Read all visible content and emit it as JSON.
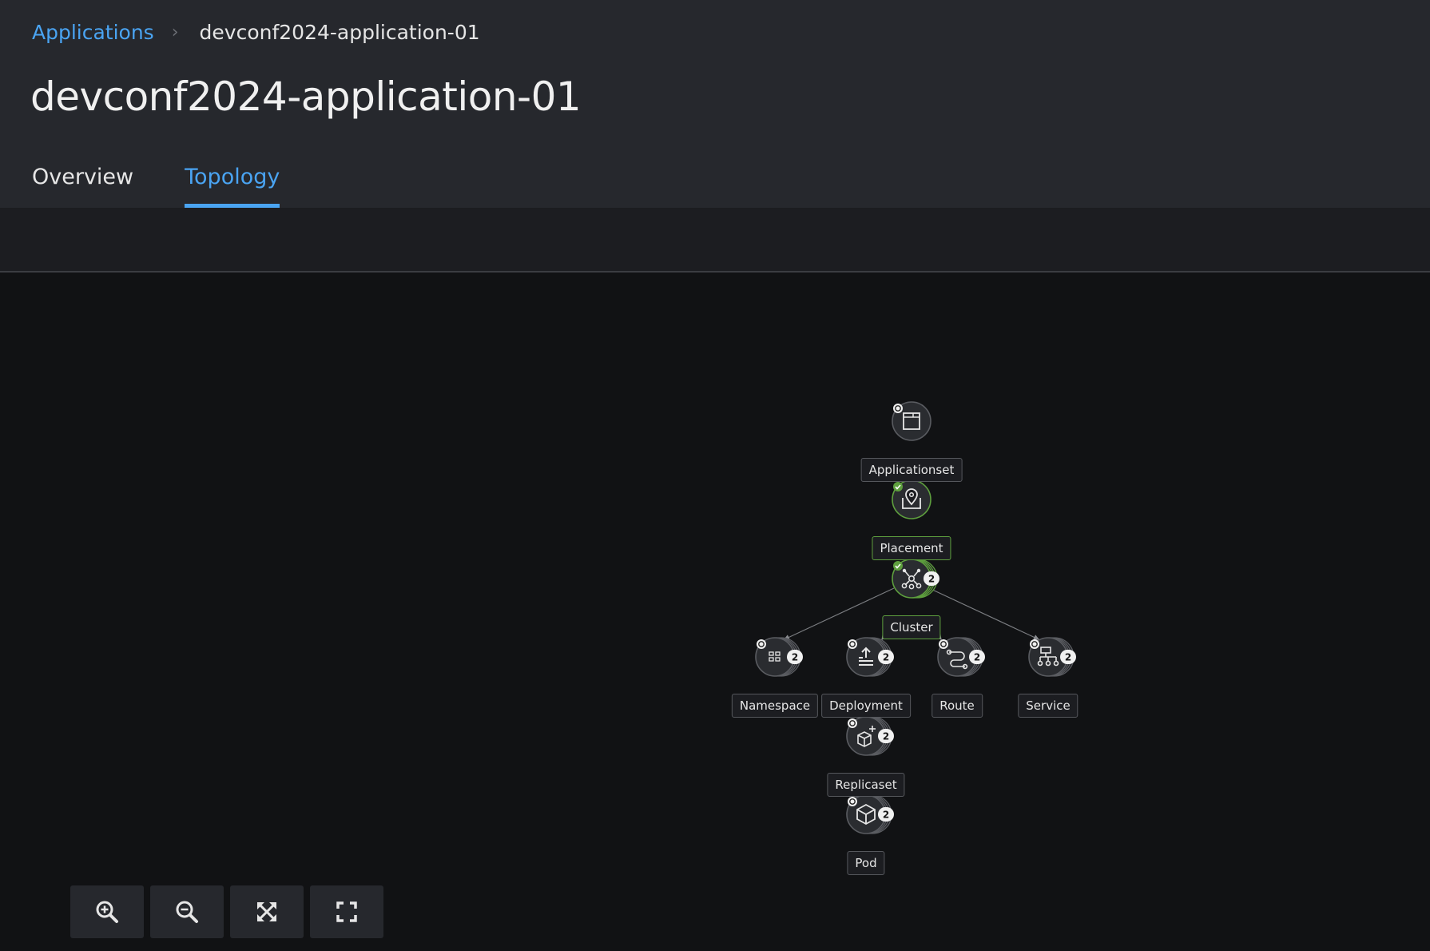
{
  "breadcrumb": {
    "parent": "Applications",
    "current": "devconf2024-application-01"
  },
  "page": {
    "title": "devconf2024-application-01"
  },
  "tabs": [
    {
      "label": "Overview",
      "active": false
    },
    {
      "label": "Topology",
      "active": true
    }
  ],
  "topology": {
    "nodes": [
      {
        "id": "applicationset",
        "label": "Applicationset",
        "icon": "applicationset-icon",
        "status": "unknown",
        "count": null
      },
      {
        "id": "placement",
        "label": "Placement",
        "icon": "placement-icon",
        "status": "ok",
        "count": null
      },
      {
        "id": "cluster",
        "label": "Cluster",
        "icon": "cluster-icon",
        "status": "ok",
        "count": "2"
      },
      {
        "id": "namespace",
        "label": "Namespace",
        "icon": "namespace-icon",
        "status": "unknown",
        "count": "2"
      },
      {
        "id": "deployment",
        "label": "Deployment",
        "icon": "deployment-icon",
        "status": "unknown",
        "count": "2"
      },
      {
        "id": "route",
        "label": "Route",
        "icon": "route-icon",
        "status": "unknown",
        "count": "2"
      },
      {
        "id": "service",
        "label": "Service",
        "icon": "service-icon",
        "status": "unknown",
        "count": "2"
      },
      {
        "id": "replicaset",
        "label": "Replicaset",
        "icon": "replicaset-icon",
        "status": "unknown",
        "count": "2"
      },
      {
        "id": "pod",
        "label": "Pod",
        "icon": "pod-icon",
        "status": "unknown",
        "count": "2"
      }
    ],
    "edges": [
      [
        "applicationset",
        "placement"
      ],
      [
        "placement",
        "cluster"
      ],
      [
        "cluster",
        "namespace"
      ],
      [
        "cluster",
        "deployment"
      ],
      [
        "cluster",
        "route"
      ],
      [
        "cluster",
        "service"
      ],
      [
        "deployment",
        "replicaset"
      ],
      [
        "replicaset",
        "pod"
      ]
    ],
    "colors": {
      "ok": "#5e9f3e",
      "link": "#4aa4f2"
    }
  },
  "controls": [
    {
      "name": "zoom-in",
      "icon": "zoom-in-icon"
    },
    {
      "name": "zoom-out",
      "icon": "zoom-out-icon"
    },
    {
      "name": "fit-to-screen",
      "icon": "fit-to-screen-icon"
    },
    {
      "name": "reset-view",
      "icon": "expand-icon"
    }
  ]
}
